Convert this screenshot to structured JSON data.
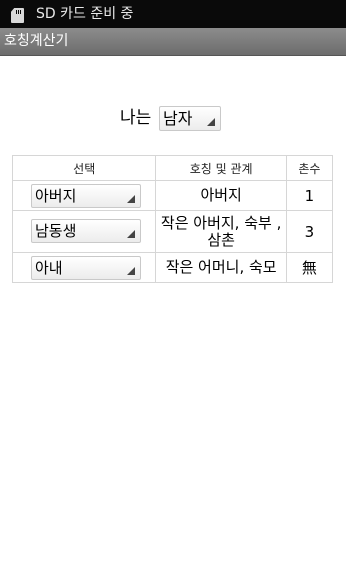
{
  "status_bar": {
    "icon": "sd-card-icon",
    "text": "SD 카드 준비 중"
  },
  "app": {
    "title": "호칭계산기"
  },
  "gender": {
    "label": "나는",
    "selected": "남자"
  },
  "table": {
    "headers": [
      "선택",
      "호칭 및 관계",
      "촌수"
    ],
    "rows": [
      {
        "selected": "아버지",
        "relation": "아버지",
        "degree": "1"
      },
      {
        "selected": "남동생",
        "relation": "작은 아버지, 숙부 , 삼촌",
        "degree": "3"
      },
      {
        "selected": "아내",
        "relation": "작은 어머니, 숙모",
        "degree": "無"
      }
    ]
  }
}
